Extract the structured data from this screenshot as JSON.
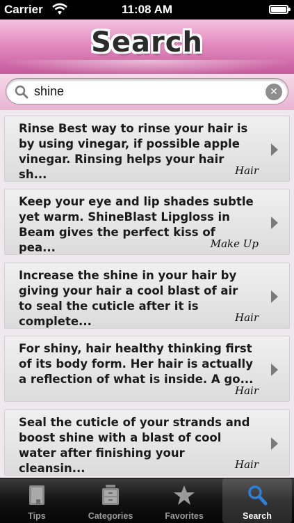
{
  "status_bar": {
    "carrier": "Carrier",
    "time": "11:08 AM"
  },
  "header": {
    "title": "Search"
  },
  "search": {
    "value": "shine"
  },
  "results": [
    {
      "text": "Rinse Best way to rinse your hair is by using vinegar, if possible apple vinegar. Rinsing helps your hair sh...",
      "category": "Hair"
    },
    {
      "text": "Keep your eye and lip shades subtle yet warm. ShineBlast Lipgloss in Beam gives the perfect kiss of pea...",
      "category": "Make Up"
    },
    {
      "text": "Increase the shine in your hair by giving your hair a cool blast of air to seal the cuticle after it is complete...",
      "category": "Hair"
    },
    {
      "text": "For shiny, hair healthy thinking first of its body form. Her hair is actually a reflection of what is inside. A go...",
      "category": "Hair"
    },
    {
      "text": "Seal the cuticle of your strands and boost shine with a blast of cool water after finishing your cleansin...",
      "category": "Hair"
    }
  ],
  "tabs": [
    {
      "label": "Tips",
      "icon": "book-icon",
      "active": false
    },
    {
      "label": "Categories",
      "icon": "drawers-icon",
      "active": false
    },
    {
      "label": "Favorites",
      "icon": "star-icon",
      "active": false
    },
    {
      "label": "Search",
      "icon": "magnifier-icon",
      "active": true
    }
  ],
  "colors": {
    "header_pink": "#e48cc1",
    "active_tab_icon": "#2f7fd8"
  }
}
